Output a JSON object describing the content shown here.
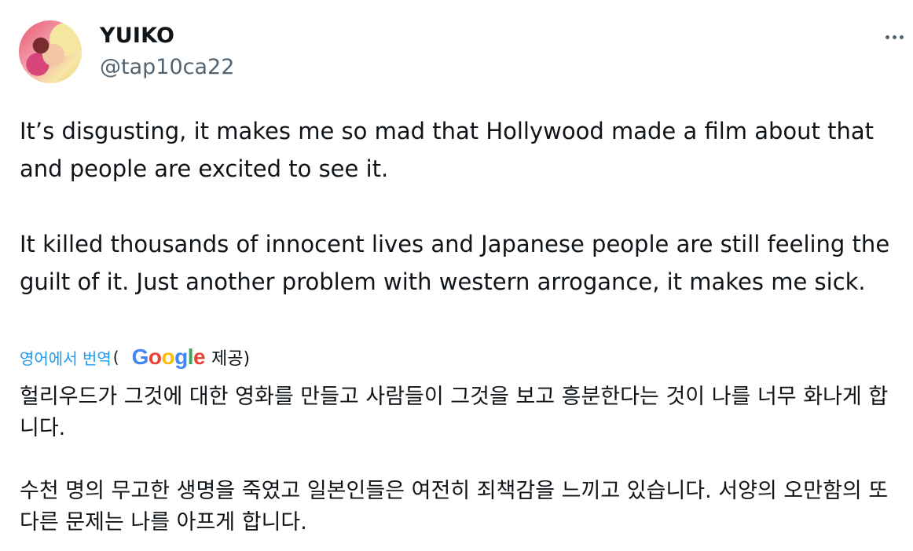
{
  "tweet": {
    "display_name": "YUIKO",
    "handle": "@tap10ca22",
    "avatar_icon": "avatar-photo",
    "more_icon": "more-dots-icon",
    "paragraphs": [
      "It’s disgusting, it makes me so mad that Hollywood made a film about that and people are excited to see it.",
      "It killed thousands of innocent lives and Japanese people are still feeling the guilt of it. Just another problem with western arrogance, it makes me sick."
    ]
  },
  "translation": {
    "link_label": "영어에서 번역",
    "open_paren": "(",
    "provider_logo": {
      "letters": [
        "G",
        "o",
        "o",
        "g",
        "l",
        "e"
      ],
      "colors": [
        "#4285F4",
        "#EA4335",
        "#FBBC05",
        "#4285F4",
        "#34A853",
        "#EA4335"
      ]
    },
    "provided_label": "제공)",
    "paragraphs": [
      "헐리우드가 그것에 대한 영화를 만들고 사람들이 그것을 보고 흥분한다는 것이 나를 너무 화나게 합니다.",
      "수천 명의 무고한 생명을 죽였고 일본인들은 여전히 죄책감을 느끼고 있습니다. 서양의 오만함의 또 다른 문제는 나를 아프게 합니다."
    ]
  },
  "colors": {
    "text": "#0f1419",
    "secondary": "#536471",
    "link": "#1d9bf0"
  }
}
